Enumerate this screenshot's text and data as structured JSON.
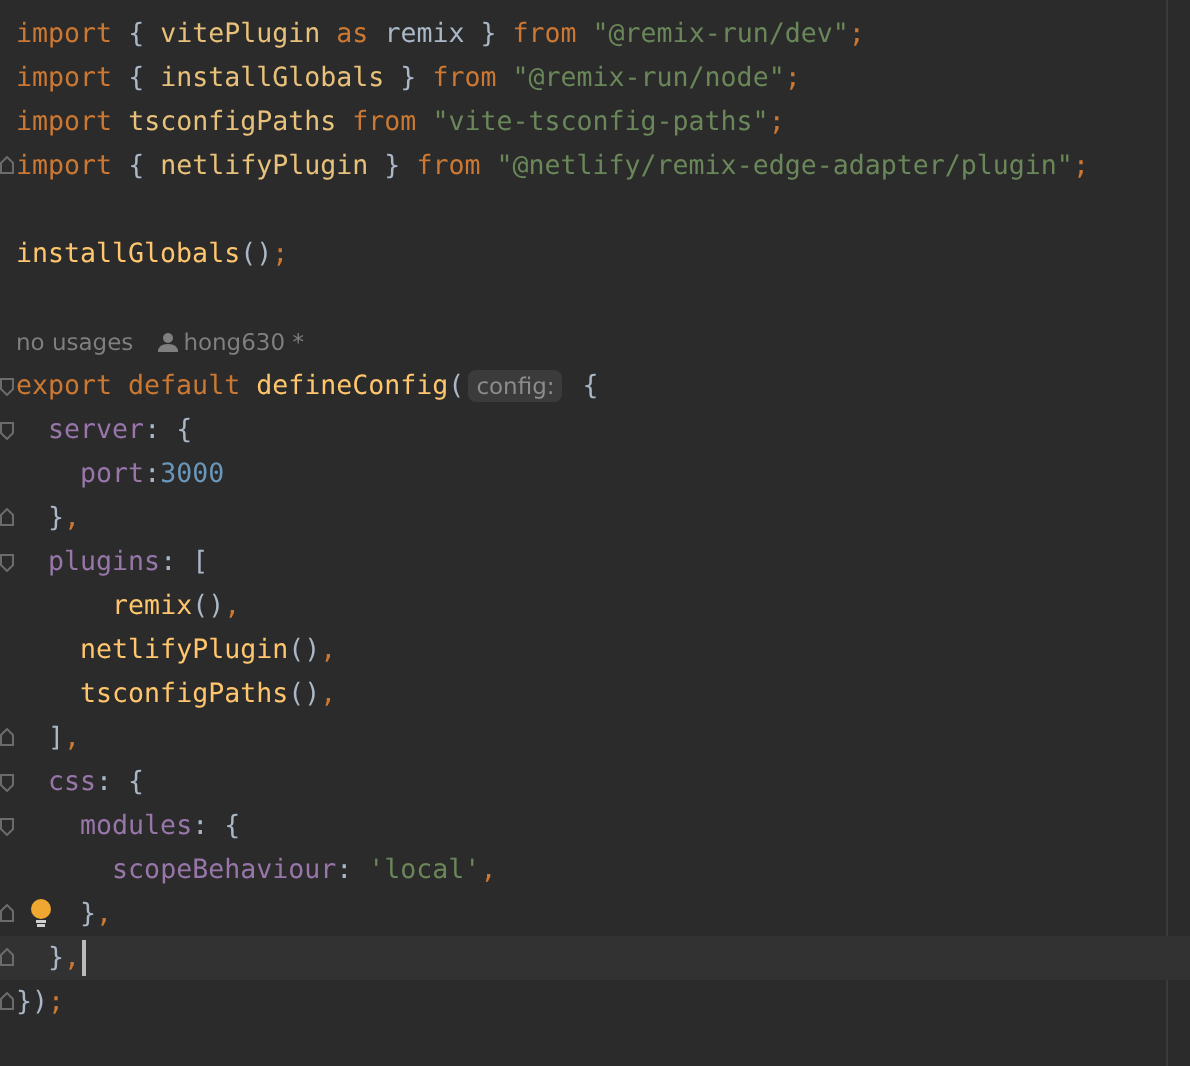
{
  "editor": {
    "lines": [
      {
        "kind": "code",
        "tokens": [
          {
            "text": "import",
            "kind": "keyword"
          },
          {
            "text": " { ",
            "kind": "punct"
          },
          {
            "text": "vitePlugin",
            "kind": "ident"
          },
          {
            "text": " as",
            "kind": "keyword"
          },
          {
            "text": " remix } ",
            "kind": "punct"
          },
          {
            "text": "from",
            "kind": "keyword"
          },
          {
            "text": " \"@remix-run/dev\"",
            "kind": "string"
          },
          {
            "text": ";",
            "kind": "keyword"
          }
        ]
      },
      {
        "kind": "code",
        "tokens": [
          {
            "text": "import",
            "kind": "keyword"
          },
          {
            "text": " { ",
            "kind": "punct"
          },
          {
            "text": "installGlobals",
            "kind": "ident"
          },
          {
            "text": " } ",
            "kind": "punct"
          },
          {
            "text": "from",
            "kind": "keyword"
          },
          {
            "text": " \"@remix-run/node\"",
            "kind": "string"
          },
          {
            "text": ";",
            "kind": "keyword"
          }
        ]
      },
      {
        "kind": "code",
        "tokens": [
          {
            "text": "import",
            "kind": "keyword"
          },
          {
            "text": " tsconfigPaths ",
            "kind": "ident"
          },
          {
            "text": "from",
            "kind": "keyword"
          },
          {
            "text": " \"vite-tsconfig-paths\"",
            "kind": "string"
          },
          {
            "text": ";",
            "kind": "keyword"
          }
        ]
      },
      {
        "kind": "code",
        "fold_close": true,
        "tokens": [
          {
            "text": "import",
            "kind": "keyword"
          },
          {
            "text": " { ",
            "kind": "punct"
          },
          {
            "text": "netlifyPlugin",
            "kind": "ident"
          },
          {
            "text": " } ",
            "kind": "punct"
          },
          {
            "text": "from",
            "kind": "keyword"
          },
          {
            "text": " \"@netlify/remix-edge-adapter/plugin\"",
            "kind": "string"
          },
          {
            "text": ";",
            "kind": "keyword"
          }
        ]
      },
      {
        "kind": "code"
      },
      {
        "kind": "code",
        "tokens": [
          {
            "text": "installGlobals",
            "kind": "func"
          },
          {
            "text": "()",
            "kind": "punct"
          },
          {
            "text": ";",
            "kind": "keyword"
          }
        ]
      },
      {
        "kind": "code"
      },
      {
        "kind": "hint",
        "usages": "no usages",
        "author": "hong630 *"
      },
      {
        "kind": "code",
        "fold_open": true,
        "tokens": [
          {
            "text": "export default",
            "kind": "keyword"
          },
          {
            "text": " defineConfig",
            "kind": "func"
          },
          {
            "text": "(",
            "kind": "punct"
          },
          {
            "text": "config:",
            "kind": "inlay"
          },
          {
            "text": " {",
            "kind": "punct"
          }
        ]
      },
      {
        "kind": "code",
        "fold_open": true,
        "tokens": [
          {
            "text": "  server",
            "kind": "prop"
          },
          {
            "text": ": {",
            "kind": "punct"
          }
        ]
      },
      {
        "kind": "code",
        "tokens": [
          {
            "text": "    port",
            "kind": "prop"
          },
          {
            "text": ":",
            "kind": "punct"
          },
          {
            "text": "3000",
            "kind": "number"
          }
        ]
      },
      {
        "kind": "code",
        "fold_close": true,
        "tokens": [
          {
            "text": "  }",
            "kind": "punct"
          },
          {
            "text": ",",
            "kind": "keyword"
          }
        ]
      },
      {
        "kind": "code",
        "fold_open": true,
        "tokens": [
          {
            "text": "  plugins",
            "kind": "prop"
          },
          {
            "text": ": [",
            "kind": "punct"
          }
        ]
      },
      {
        "kind": "code",
        "tokens": [
          {
            "text": "      remix",
            "kind": "func"
          },
          {
            "text": "()",
            "kind": "punct"
          },
          {
            "text": ",",
            "kind": "keyword"
          }
        ]
      },
      {
        "kind": "code",
        "tokens": [
          {
            "text": "    netlifyPlugin",
            "kind": "func"
          },
          {
            "text": "()",
            "kind": "punct"
          },
          {
            "text": ",",
            "kind": "keyword"
          }
        ]
      },
      {
        "kind": "code",
        "tokens": [
          {
            "text": "    tsconfigPaths",
            "kind": "func"
          },
          {
            "text": "()",
            "kind": "punct"
          },
          {
            "text": ",",
            "kind": "keyword"
          }
        ]
      },
      {
        "kind": "code",
        "fold_close": true,
        "tokens": [
          {
            "text": "  ]",
            "kind": "punct"
          },
          {
            "text": ",",
            "kind": "keyword"
          }
        ]
      },
      {
        "kind": "code",
        "fold_open": true,
        "tokens": [
          {
            "text": "  css",
            "kind": "prop"
          },
          {
            "text": ": {",
            "kind": "punct"
          }
        ]
      },
      {
        "kind": "code",
        "fold_open": true,
        "tokens": [
          {
            "text": "    modules",
            "kind": "prop"
          },
          {
            "text": ": {",
            "kind": "punct"
          }
        ]
      },
      {
        "kind": "code",
        "tokens": [
          {
            "text": "      scopeBehaviour",
            "kind": "prop"
          },
          {
            "text": ": ",
            "kind": "punct"
          },
          {
            "text": "'local'",
            "kind": "string"
          },
          {
            "text": ",",
            "kind": "keyword"
          }
        ]
      },
      {
        "kind": "code",
        "fold_close": true,
        "bulb": true,
        "tokens": [
          {
            "text": "    }",
            "kind": "punct"
          },
          {
            "text": ",",
            "kind": "keyword"
          }
        ]
      },
      {
        "kind": "code",
        "fold_close": true,
        "current": true,
        "tokens": [
          {
            "text": "  }",
            "kind": "punct"
          },
          {
            "text": ",",
            "kind": "keyword"
          }
        ]
      },
      {
        "kind": "code",
        "fold_close": true,
        "tokens": [
          {
            "text": "})",
            "kind": "punct"
          },
          {
            "text": ";",
            "kind": "keyword"
          }
        ]
      }
    ]
  }
}
